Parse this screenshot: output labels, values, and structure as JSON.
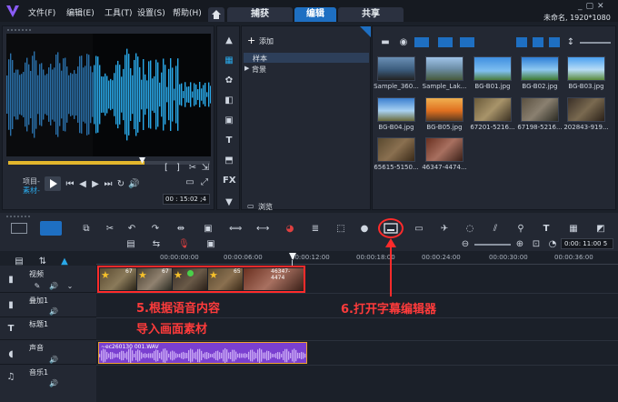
{
  "menu": [
    "文件(F)",
    "编辑(E)",
    "工具(T)",
    "设置(S)",
    "帮助(H)"
  ],
  "tabs": {
    "capture": "捕获",
    "edit": "编辑",
    "share": "共享"
  },
  "project_info": "未命名, 1920*1080",
  "player": {
    "project_label": "项目-",
    "clip_label": "素材-",
    "timecode": "00 : 15:02 ;4"
  },
  "library": {
    "add_label": "添加",
    "tree": [
      "样本",
      "背景"
    ],
    "browse_label": "浏览",
    "thumbs": [
      "Sample_360...",
      "Sample_Lak...",
      "BG-B01.jpg",
      "BG-B02.jpg",
      "BG-B03.jpg",
      "BG-B04.jpg",
      "BG-B05.jpg",
      "67201-5216...",
      "67198-5216...",
      "202843-919...",
      "65615-5150...",
      "46347-4474..."
    ]
  },
  "timeline": {
    "zoom_timecode": "0:00: 11:00 5",
    "ruler": [
      "00:00:00:00",
      "00:00:06:00",
      "00:00:12:00",
      "00:00:18:00",
      "00:00:24:00",
      "00:00:30:00",
      "00:00:36:00"
    ],
    "tracks": [
      "视频",
      "叠加1",
      "标题1",
      "声音",
      "音乐1"
    ],
    "clip_labels": [
      "67",
      "67",
      "65",
      "46347-4474"
    ],
    "audio_clip": "~ec260130 001.WAV"
  },
  "annotations": {
    "step5_line1": "5.根据语音内容",
    "step5_line2": "导入画面素材",
    "step6": "6.打开字幕编辑器"
  },
  "colors": {
    "accent": "#1e6fc2",
    "wave": "#21a4e6",
    "annotation": "#ff3b3b",
    "audio": "#8a4fd6"
  }
}
